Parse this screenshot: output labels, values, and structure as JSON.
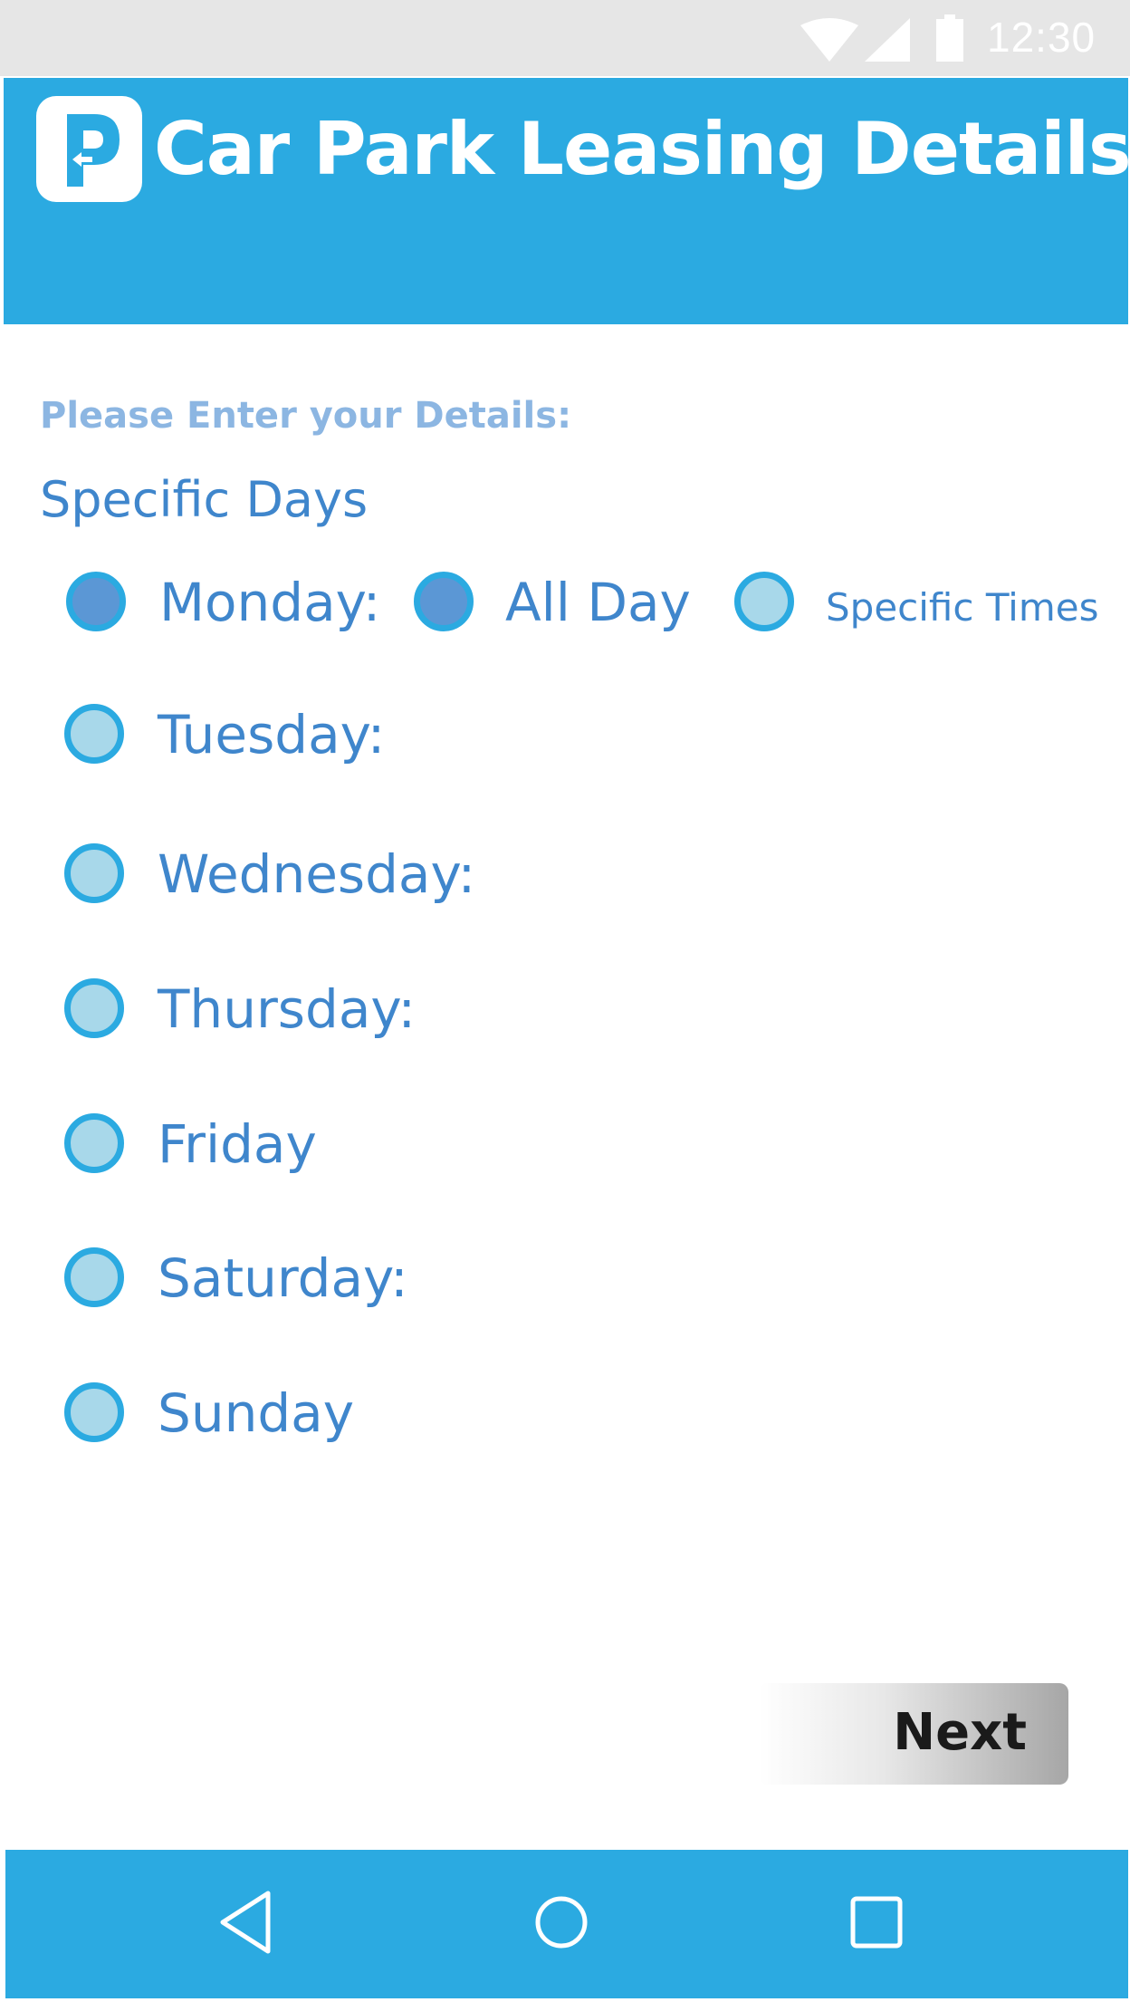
{
  "status_bar": {
    "time": "12:30",
    "icons": [
      "wifi-icon",
      "signal-icon",
      "battery-icon"
    ]
  },
  "header": {
    "title": "Car Park Leasing Details",
    "logo_icon": "parking-logo-icon",
    "background": "#2baae1"
  },
  "form": {
    "prompt": "Please Enter your Details:",
    "section_title": "Specific Days",
    "days": [
      {
        "label": "Monday:",
        "selected": true
      },
      {
        "label": "Tuesday:",
        "selected": false
      },
      {
        "label": "Wednesday:",
        "selected": false
      },
      {
        "label": "Thursday:",
        "selected": false
      },
      {
        "label": "Friday",
        "selected": false
      },
      {
        "label": "Saturday:",
        "selected": false
      },
      {
        "label": "Sunday",
        "selected": false
      }
    ],
    "monday_options": [
      {
        "label": "All Day",
        "selected": true
      },
      {
        "label": "Specific Times",
        "selected": false
      }
    ]
  },
  "actions": {
    "next_label": "Next"
  },
  "nav_bar": {
    "icons": [
      "back-icon",
      "home-icon",
      "recents-icon"
    ]
  },
  "colors": {
    "accent": "#2baae1",
    "text_blue": "#3f86cc",
    "radio_unselected": "#a8d8ea",
    "radio_selected": "#5b97d5"
  }
}
